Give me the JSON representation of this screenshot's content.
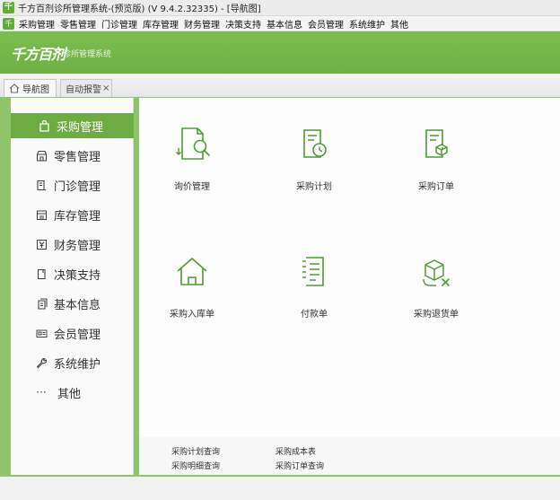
{
  "window": {
    "icon_glyph": "千",
    "title": "千方百剂诊所管理系统-(预览版) (V 9.4.2.32335)   - [导航图]"
  },
  "menubar": {
    "icon_glyph": "千",
    "items": [
      "采购管理",
      "零售管理",
      "门诊管理",
      "库存管理",
      "财务管理",
      "决策支持",
      "基本信息",
      "会员管理",
      "系统维护",
      "其他"
    ]
  },
  "banner": {
    "logo_text": "千方百剂",
    "subtitle": "诊所管理系统",
    "color": "#72b447"
  },
  "tabs": [
    {
      "label": "导航图",
      "icon": "home-icon",
      "active": true
    },
    {
      "label": "自动报警",
      "close_glyph": "×",
      "active": false
    }
  ],
  "sidebar": {
    "active_color": "#6dab43",
    "items": [
      {
        "label": "采购管理",
        "icon": "bag-icon",
        "active": true
      },
      {
        "label": "零售管理",
        "icon": "store-icon"
      },
      {
        "label": "门诊管理",
        "icon": "clinic-icon"
      },
      {
        "label": "库存管理",
        "icon": "warehouse-icon"
      },
      {
        "label": "财务管理",
        "icon": "finance-icon"
      },
      {
        "label": "决策支持",
        "icon": "decision-icon"
      },
      {
        "label": "基本信息",
        "icon": "info-icon"
      },
      {
        "label": "会员管理",
        "icon": "member-card-icon"
      },
      {
        "label": "系统维护",
        "icon": "wrench-icon"
      },
      {
        "label": "其他",
        "icon": "more-dots-icon",
        "glyph": "···"
      }
    ]
  },
  "main": {
    "tiles": [
      {
        "label": "询价管理",
        "icon": "inquiry-icon"
      },
      {
        "label": "采购计划",
        "icon": "purchase-plan-icon"
      },
      {
        "label": "采购订单",
        "icon": "purchase-order-icon"
      },
      {
        "label": "采购入库单",
        "icon": "stock-in-icon"
      },
      {
        "label": "付款单",
        "icon": "payment-icon"
      },
      {
        "label": "采购退货单",
        "icon": "purchase-return-icon"
      }
    ]
  },
  "reports": {
    "items": [
      "采购计划查询",
      "采购成本表",
      "采购明细查询",
      "采购订单查询"
    ]
  }
}
